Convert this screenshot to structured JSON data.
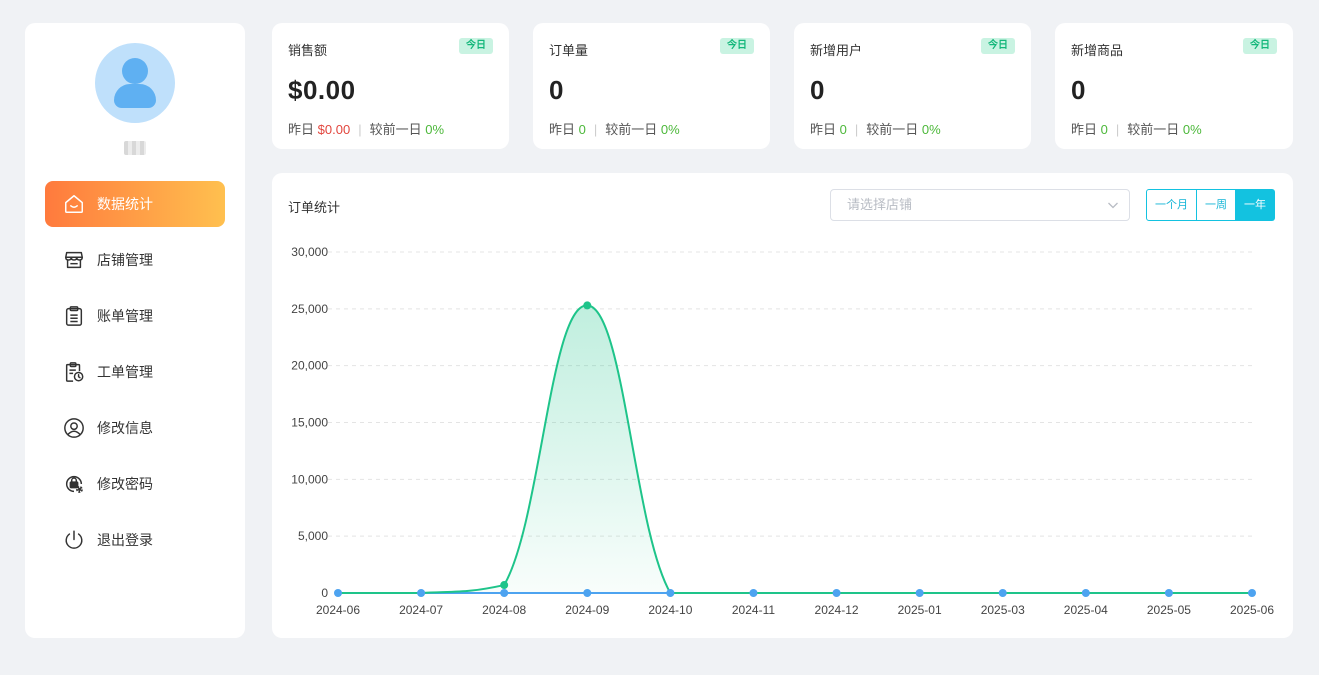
{
  "sidebar": {
    "username": "",
    "menu": [
      {
        "label": "数据统计",
        "icon": "home-icon"
      },
      {
        "label": "店铺管理",
        "icon": "store-icon"
      },
      {
        "label": "账单管理",
        "icon": "bill-icon"
      },
      {
        "label": "工单管理",
        "icon": "work-order-icon"
      },
      {
        "label": "修改信息",
        "icon": "user-icon"
      },
      {
        "label": "修改密码",
        "icon": "lock-gear-icon"
      },
      {
        "label": "退出登录",
        "icon": "power-icon"
      }
    ]
  },
  "cards": [
    {
      "title": "销售额",
      "badge": "今日",
      "value": "$0.00",
      "yesterday_label": "昨日",
      "yesterday": "$0.00",
      "compare_label": "较前一日",
      "compare": "0%"
    },
    {
      "title": "订单量",
      "badge": "今日",
      "value": "0",
      "yesterday_label": "昨日",
      "yesterday": "0",
      "compare_label": "较前一日",
      "compare": "0%"
    },
    {
      "title": "新增用户",
      "badge": "今日",
      "value": "0",
      "yesterday_label": "昨日",
      "yesterday": "0",
      "compare_label": "较前一日",
      "compare": "0%"
    },
    {
      "title": "新增商品",
      "badge": "今日",
      "value": "0",
      "yesterday_label": "昨日",
      "yesterday": "0",
      "compare_label": "较前一日",
      "compare": "0%"
    }
  ],
  "panel": {
    "title": "订单统计",
    "select_placeholder": "请选择店铺",
    "ranges": [
      "一个月",
      "一周",
      "一年"
    ],
    "active_range": "一年"
  },
  "colors": {
    "accent_start": "#ff7a3d",
    "accent_end": "#ffc04f",
    "badge_bg": "#c9f3e2",
    "badge_text": "#13b77a",
    "range_active": "#13c2e0",
    "series_green": "#1ec48a",
    "series_blue": "#4da3f0"
  },
  "chart_data": {
    "type": "line",
    "categories": [
      "2024-06",
      "2024-07",
      "2024-08",
      "2024-09",
      "2024-10",
      "2024-11",
      "2024-12",
      "2025-01",
      "2025-03",
      "2025-04",
      "2025-05",
      "2025-06"
    ],
    "ylim": [
      0,
      30000
    ],
    "yticks": [
      "0",
      "5,000",
      "10,000",
      "15,000",
      "20,000",
      "25,000",
      "30,000"
    ],
    "grid": true,
    "series": [
      {
        "values": [
          0,
          0,
          700,
          25300,
          0,
          0,
          0,
          0,
          0,
          0,
          0,
          0
        ],
        "color": "#1ec48a",
        "area": true,
        "markers": [
          2,
          3
        ]
      },
      {
        "values": [
          0,
          0,
          0,
          0,
          0,
          0,
          0,
          0,
          0,
          0,
          0,
          0
        ],
        "color": "#4da3f0",
        "area": false
      }
    ]
  }
}
